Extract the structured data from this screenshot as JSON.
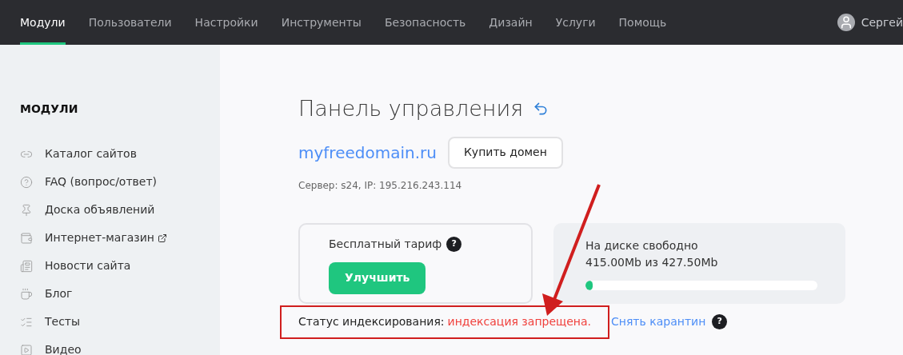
{
  "nav": {
    "items": [
      {
        "label": "Модули",
        "selected": true
      },
      {
        "label": "Пользователи",
        "selected": false
      },
      {
        "label": "Настройки",
        "selected": false
      },
      {
        "label": "Инструменты",
        "selected": false
      },
      {
        "label": "Безопасность",
        "selected": false
      },
      {
        "label": "Дизайн",
        "selected": false
      },
      {
        "label": "Услуги",
        "selected": false
      },
      {
        "label": "Помощь",
        "selected": false
      }
    ],
    "user": "Сергей"
  },
  "sidebar": {
    "title": "МОДУЛИ",
    "items": [
      {
        "label": "Каталог сайтов",
        "kind": "catalog"
      },
      {
        "label": "FAQ (вопрос/ответ)",
        "kind": "faq"
      },
      {
        "label": "Доска объявлений",
        "kind": "pin"
      },
      {
        "label": "Интернет-магазин",
        "kind": "shop",
        "external": true
      },
      {
        "label": "Новости сайта",
        "kind": "news"
      },
      {
        "label": "Блог",
        "kind": "cup"
      },
      {
        "label": "Тесты",
        "kind": "tests"
      },
      {
        "label": "Видео",
        "kind": "video"
      }
    ]
  },
  "main": {
    "title": "Панель управления",
    "domain": "myfreedomain.ru",
    "buy_button": "Купить домен",
    "server": "Сервер: s24, IP: 195.216.243.114",
    "plan": {
      "label": "Бесплатный тариф",
      "help": "?",
      "button": "Улучшить"
    },
    "disk": {
      "label": "На диске свободно",
      "reading": "415.00Mb из 427.50Mb",
      "level": 0.03
    },
    "status": {
      "label": "Статус индексирования:",
      "value": "индексация запрещена.",
      "link": "Снять карантин",
      "help": "?",
      "highlighted": true
    }
  }
}
